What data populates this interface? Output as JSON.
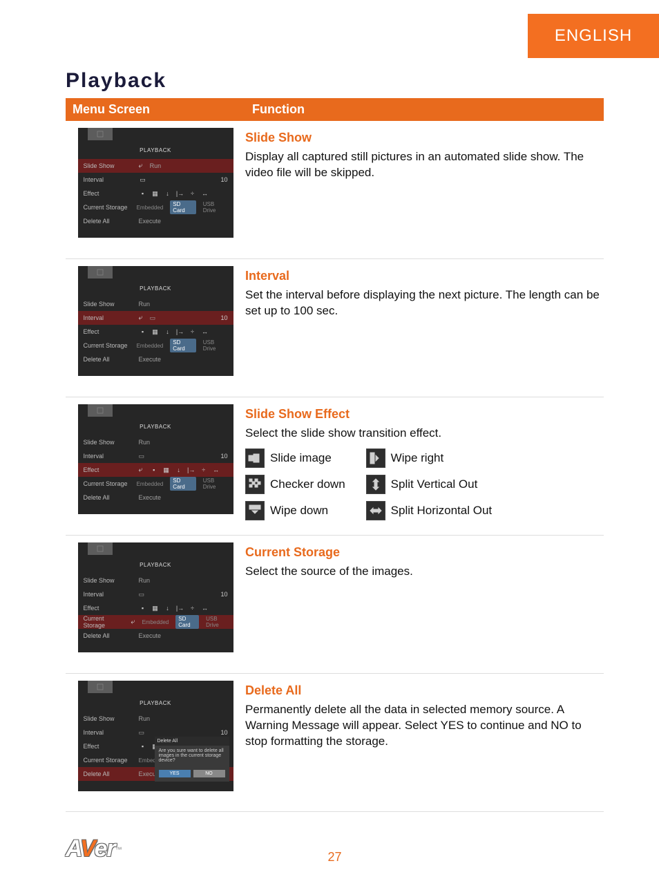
{
  "language_tab": "ENGLISH",
  "heading": "Playback",
  "table_header": {
    "left": "Menu Screen",
    "right": "Function"
  },
  "menu": {
    "title": "PLAYBACK",
    "items": {
      "slide_show": "Slide Show",
      "interval": "Interval",
      "effect": "Effect",
      "current_storage": "Current Storage",
      "delete_all": "Delete All",
      "run": "Run",
      "execute": "Execute",
      "storage_opts": {
        "embedded": "Embedded",
        "sd": "SD Card",
        "usb": "USB Drive"
      },
      "interval_val": "10"
    },
    "delete_popup": {
      "title": "Delete All",
      "msg": "Are you sure want to delete all images in the current storage device?",
      "yes": "YES",
      "no": "NO"
    }
  },
  "rows": {
    "slide_show": {
      "title": "Slide Show",
      "body": "Display all captured still pictures in an automated slide show. The video file will be skipped."
    },
    "interval": {
      "title": "Interval",
      "body": "Set the interval before displaying the next picture. The length can be set up to 100 sec."
    },
    "effect": {
      "title": "Slide Show Effect",
      "body": "Select the slide show transition effect.",
      "effects": {
        "slide_image": "Slide image",
        "checker_down": "Checker down",
        "wipe_down": "Wipe down",
        "wipe_right": "Wipe right",
        "split_v": "Split Vertical Out",
        "split_h": "Split Horizontal Out"
      }
    },
    "storage": {
      "title": "Current Storage",
      "body": "Select the source of the images."
    },
    "delete_all": {
      "title": "Delete All",
      "body": "Permanently delete all the data in selected memory source. A Warning Message will appear. Select YES to continue and NO to stop formatting the storage."
    }
  },
  "footer": {
    "page": "27",
    "brand": "AVer"
  }
}
